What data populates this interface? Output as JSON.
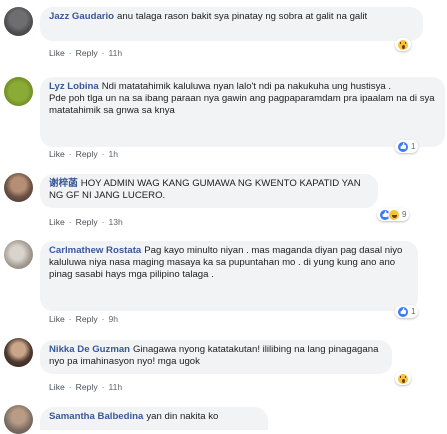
{
  "actions": {
    "like": "Like",
    "reply": "Reply",
    "sep": "·"
  },
  "comments": [
    {
      "author": "Jazz Gaudario",
      "text": "anu talaga rason bakit sya pinatay ng sobra at galit na galit",
      "time": "11h",
      "reactions": [
        "wow"
      ]
    },
    {
      "author": "Lyz Lobina",
      "text_line1": "Ndi matatahimik kaluluwa nyan lalo't ndi pa nakukuha ung hustisya .",
      "text_line2": "Pde poh tlga un na sa ibang paraan nya gawin ang pagpaparamdam pra ipaalam na di sya matatahimik sa gnwa sa knya",
      "time": "1h",
      "reactions": [
        "like"
      ],
      "reaction_count": "1"
    },
    {
      "author": "谢梓菡",
      "text": "HOY ADMIN WAG KANG GUMAWA NG KWENTO KAPATID YAN NG GF NI JANG LUCERO.",
      "time": "13h",
      "reactions": [
        "like",
        "haha"
      ],
      "reaction_count": "9"
    },
    {
      "author": "Carlmathew Rostata",
      "text": "Pag kayo minulto niyan . mas maganda diyan pag dasal niyo kaluluwa niya nasa maging masaya ka sa pupuntahan mo . di yung kung ano ano pinag sasabi hays mga pilipino talaga .",
      "time": "9h",
      "reactions": [
        "like"
      ],
      "reaction_count": "1"
    },
    {
      "author": "Nikka De Guzman",
      "text": "Ginagawa nyong katatakutan! ililibing na lang pinagagana nyo pa imahinasyon nyo! mga ugok",
      "time": "11h",
      "reactions": [
        "wow"
      ]
    },
    {
      "author": "Samantha Balbedina",
      "text": "yan din nakita ko"
    }
  ]
}
